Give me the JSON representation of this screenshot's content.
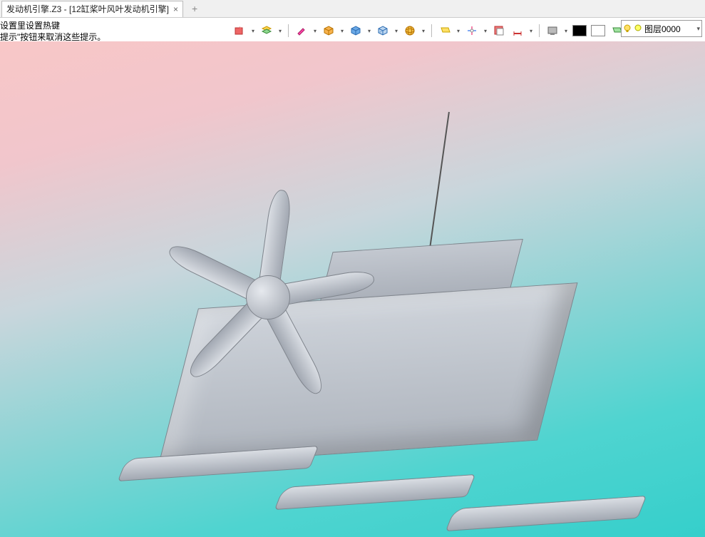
{
  "tab": {
    "title_partial": "发动机引擎.Z3 - [12缸桨叶风叶发动机引擎]",
    "close": "×",
    "add": "+"
  },
  "hints": {
    "line1_partial": "设置里设置热键",
    "line2_partial": "提示\"按钮来取消这些提示。"
  },
  "toolbar": {
    "colors": {
      "black": "#000000",
      "white": "#ffffff"
    }
  },
  "layer": {
    "label": "图层0000"
  }
}
